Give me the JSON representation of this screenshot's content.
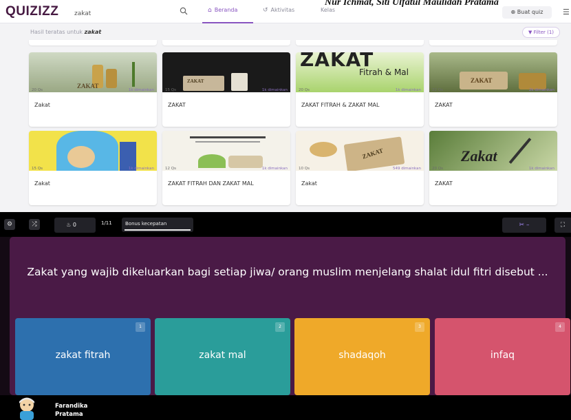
{
  "corner_note": "Nur Ichmat, Siti Ulfatul Maulidah Pratama",
  "navbar": {
    "logo": "QUIZIZZ",
    "search_value": "zakat",
    "tabs": [
      {
        "label": "Beranda",
        "icon": "home-icon",
        "active": true
      },
      {
        "label": "Aktivitas",
        "icon": "history-icon",
        "active": false
      },
      {
        "label": "Kelas",
        "icon": "",
        "active": false
      }
    ],
    "create_quiz_label": "Buat quiz",
    "accent_color": "#8854c0"
  },
  "results": {
    "heading_prefix": "Hasil teratas untuk",
    "heading_query": "zakat",
    "filter_label": "Filter (1)",
    "cards": [
      {
        "title": "Zakat",
        "questions": "20 Qs",
        "plays": "1k dimainkan",
        "thumb_text": "ZAKAT"
      },
      {
        "title": "ZAKAT",
        "questions": "15 Qs",
        "plays": "1k dimainkan",
        "thumb_text": "ZAKAT"
      },
      {
        "title": "ZAKAT FITRAH & ZAKAT MAL",
        "questions": "20 Qs",
        "plays": "1k dimainkan",
        "thumb_text": "ZAKAT",
        "thumb_sub": "Fitrah & Mal"
      },
      {
        "title": "ZAKAT",
        "questions": "22 Qs",
        "plays": "2k dimainkan",
        "thumb_text": "ZAKAT"
      },
      {
        "title": "Zakat",
        "questions": "15 Qs",
        "plays": "1k dimainkan",
        "thumb_text": ""
      },
      {
        "title": "ZAKAT FITRAH DAN ZAKAT MAL",
        "questions": "12 Qs",
        "plays": "1k dimainkan",
        "thumb_text": ""
      },
      {
        "title": "Zakat",
        "questions": "10 Qs",
        "plays": "549 dimainkan",
        "thumb_text": "ZAKAT"
      },
      {
        "title": "ZAKAT",
        "questions": "20 Qs",
        "plays": "1k dimainkan",
        "thumb_text": "Zakat"
      }
    ]
  },
  "game": {
    "streak": "0",
    "question_counter": "1/11",
    "bonus_label": "Bonus kecepatan",
    "bonus_fraction": 1.0,
    "powerup_label": "–",
    "question": "Zakat yang wajib dikeluarkan bagi setiap jiwa/ orang muslim menjelang shalat idul fitri disebut ...",
    "options": [
      {
        "number": "1",
        "label": "zakat fitrah",
        "color": "#2d70ae"
      },
      {
        "number": "2",
        "label": "zakat mal",
        "color": "#2a9d9a"
      },
      {
        "number": "3",
        "label": "shadaqoh",
        "color": "#efa929"
      },
      {
        "number": "4",
        "label": "infaq",
        "color": "#d5546d"
      }
    ],
    "player_name": "Farandika Pratama"
  }
}
